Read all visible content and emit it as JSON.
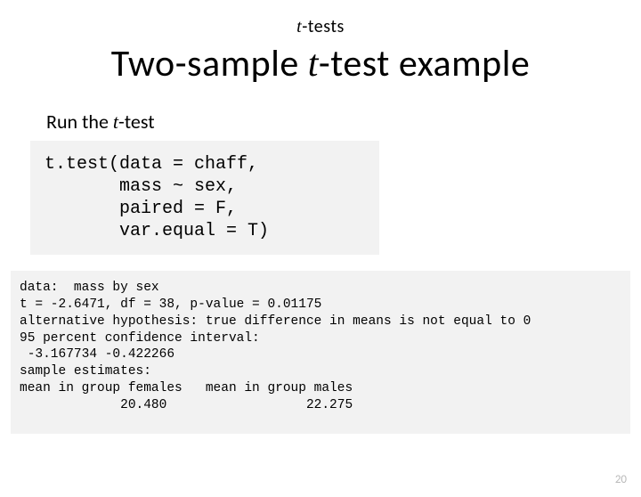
{
  "topic": {
    "prefix_italic": "t",
    "rest": "-tests"
  },
  "title": {
    "before": "Two-sample ",
    "italic": "t",
    "after": "-test example"
  },
  "subhead": {
    "before": "Run the ",
    "italic": "t",
    "after": "-test"
  },
  "code": "t.test(data = chaff,\n       mass ~ sex,\n       paired = F,\n       var.equal = T)",
  "output": "data:  mass by sex\nt = -2.6471, df = 38, p-value = 0.01175\nalternative hypothesis: true difference in means is not equal to 0\n95 percent confidence interval:\n -3.167734 -0.422266\nsample estimates:\nmean in group females   mean in group males\n             20.480                  22.275",
  "page_number": "20"
}
